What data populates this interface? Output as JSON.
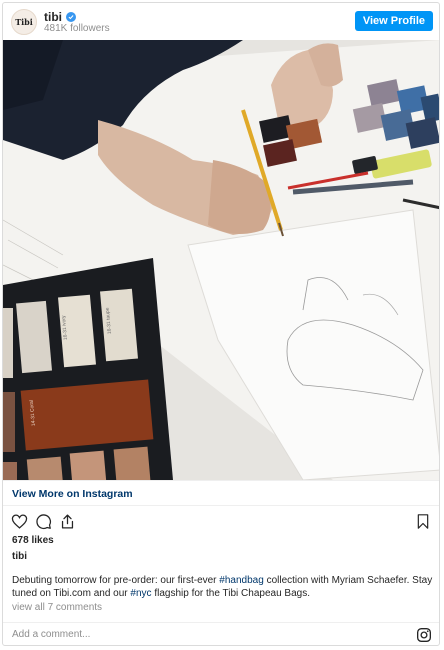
{
  "header": {
    "avatar_text": "Tibi",
    "username": "tibi",
    "followers": "481K followers",
    "view_profile_label": "View Profile"
  },
  "photo": {
    "swatch_labels": [
      "16-31 ivory",
      "16-31 taupe",
      "14-31 Coral"
    ]
  },
  "footer": {
    "view_more_label": "View More on Instagram",
    "likes": "678 likes",
    "caption_user": "tibi",
    "caption_parts": {
      "p1": "Debuting tomorrow for pre-order: our first-ever ",
      "tag1": "#handbag",
      "p2": " collection with Myriam Schaefer. Stay tuned on Tibi.com and our ",
      "tag2": "#nyc",
      "p3": " flagship for the Tibi Chapeau Bags."
    },
    "view_all_comments": "view all 7 comments",
    "comment_placeholder": "Add a comment..."
  },
  "icons": {
    "like": "heart-icon",
    "comment": "comment-icon",
    "share": "share-icon",
    "save": "bookmark-icon",
    "instagram": "instagram-logo-icon",
    "verified": "verified-badge-icon"
  },
  "colors": {
    "button": "#0095f6",
    "link": "#00376b",
    "muted": "#8e8e8e"
  }
}
